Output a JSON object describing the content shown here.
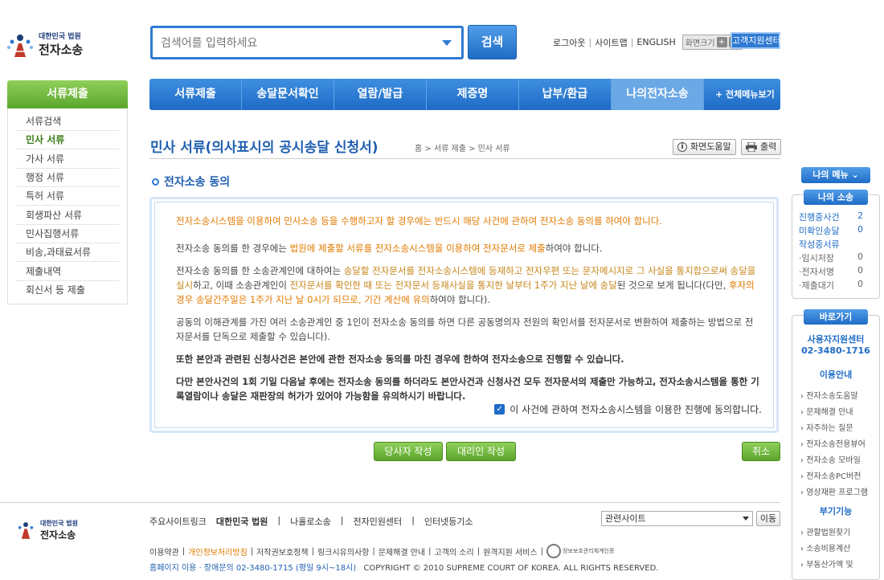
{
  "header": {
    "logo_small": "대한민국 법원",
    "logo_big": "전자소송",
    "search_placeholder": "검색어를 입력하세요",
    "search_button": "검색",
    "util_links": [
      "로그아웃",
      "사이트맵",
      "ENGLISH"
    ],
    "zoom_label": "화면크기",
    "zoom_plus": "+",
    "zoom_minus": "-",
    "help_center": "고객지원센터"
  },
  "nav": {
    "tabs": [
      "서류제출",
      "송달문서확인",
      "열람/발급",
      "제증명",
      "납부/환급",
      "나의전자소송"
    ],
    "all_menu": "+ 전체메뉴보기"
  },
  "left_nav": {
    "title": "서류제출",
    "items": [
      "서류검색",
      "민사 서류",
      "가사 서류",
      "행정 서류",
      "특허 서류",
      "회생파산 서류",
      "민사집행서류",
      "비송,과태료서류",
      "제출내역",
      "회신서 등 제출"
    ]
  },
  "page": {
    "title": "민사 서류(의사표시의 공시송달 신청서)",
    "breadcrumb": "홈 > 서류 제출 > 민사 서류",
    "help_button": "화면도움말",
    "print_button": "출력",
    "section_title": "전자소송 동의"
  },
  "content": {
    "p1": "전자소송시스템을 이용하여 민사소송 등을 수행하고자 할 경우에는 반드시 해당 사건에 관하여 전자소송 동의를 하여야 합니다.",
    "p2a": "전자소송 동의를 한 경우에는 ",
    "p2b": "법원에 제출할 서류를 전자소송시스템을 이용하여 전자문서로 제출",
    "p2c": "하여야 합니다.",
    "p3a": "전자소송 동의를 한 소송관계인에 대하여는 ",
    "p3b": "송달할 전자문서를 전자소송시스템에 등재하고 전자우편 또는 문자메시지로 그 사실을 통지합으로써 송달을 실시",
    "p3c": "하고, 이때 소송관계인이 ",
    "p3d": "전자문서를 확인한 때 또는 전자문서 등재사실을 통지한 날부터 1주가 지난 날에 송달",
    "p3e": "된 것으로 보게 됩니다(다만, ",
    "p3f": "후자의 경우 송달간주일은 1주가 지난 날 0시가 되므로, 기간 계산에 유의",
    "p3g": "하여야 합니다).",
    "p4": "공동의 이해관계를 가진 여러 소송관계인 중 1인이 전자소송 동의를 하면 다른 공동명의자 전원의 확인서를 전자문서로 변환하여 제출하는 방법으로 전자문서를 단독으로 제출할 수 있습니다).",
    "p5": "또한 본안과 관련된 신청사건은 본안에 관한 전자소송 동의를 마친 경우에 한하여 전자소송으로 진행할 수 있습니다.",
    "p6": "다만 본안사건의 1회 기일 다음날 후에는 전자소송 동의를 하더라도 본안사건과 신청사건 모두 전자문서의 제출만 가능하고, 전자소송시스템을 통한 기록열람이나 송달은 재판장의 허가가 있어야 가능함을 유의하시기 바랍니다.",
    "agree_label": "이 사건에 관하여 전자소송시스템을 이용한 진행에 동의합니다.",
    "agree_checked": true
  },
  "buttons": {
    "party": "당사자 작성",
    "agent": "대리인 작성",
    "cancel": "취소"
  },
  "footer": {
    "links": [
      "주요사이트링크",
      "대한민국 법원",
      "나홀로소송",
      "전자민원센터",
      "인터넷등기소"
    ],
    "related_select": "관련사이트",
    "go_button": "이동",
    "row2": [
      "이용약관",
      "개인정보처리방침",
      "저작권보호정책",
      "링크시유의사항",
      "문제해결 안내",
      "고객의 소리",
      "원격지원 서비스"
    ],
    "cert_label": "정보보호관리체계인증",
    "row3_a": "홈페이지 이용 · 장애문의 02-3480-1715 (평일 9시~18시)",
    "row3_b": "COPYRIGHT © 2010 SUPREME COURT OF KOREA. ALL RIGHTS RESERVED."
  },
  "right_sidebar": {
    "my_menu": "나의 메뉴",
    "my_lawsuit": "나의 소송",
    "rows": [
      {
        "label": "진행중사건",
        "value": "2"
      },
      {
        "label": "미확인송달",
        "value": "0"
      }
    ],
    "drafting": "작성중서류",
    "sub_rows": [
      {
        "label": "·임시저장",
        "value": "0"
      },
      {
        "label": "·전자서명",
        "value": "0"
      },
      {
        "label": "·제출대기",
        "value": "0"
      }
    ],
    "shortcut": "바로가기",
    "support_center": "사용자지원센터",
    "support_phone": "02-3480-1716",
    "usage_guide": "이용안내",
    "usage_items": [
      "전자소송도움말",
      "문제해결 안내",
      "자주하는 질문",
      "전자소송전용뷰어",
      "전자소송 모바일",
      "전자소송PC버전",
      "영상재판 프로그램"
    ],
    "calc_title": "부기기능",
    "calc_items": [
      "관할법원찾기",
      "소송비용계산",
      "부동산가액 및"
    ]
  },
  "colors": {
    "accent_blue": "#1f6cc7",
    "green": "#5ba52c",
    "orange": "#e27a00"
  }
}
